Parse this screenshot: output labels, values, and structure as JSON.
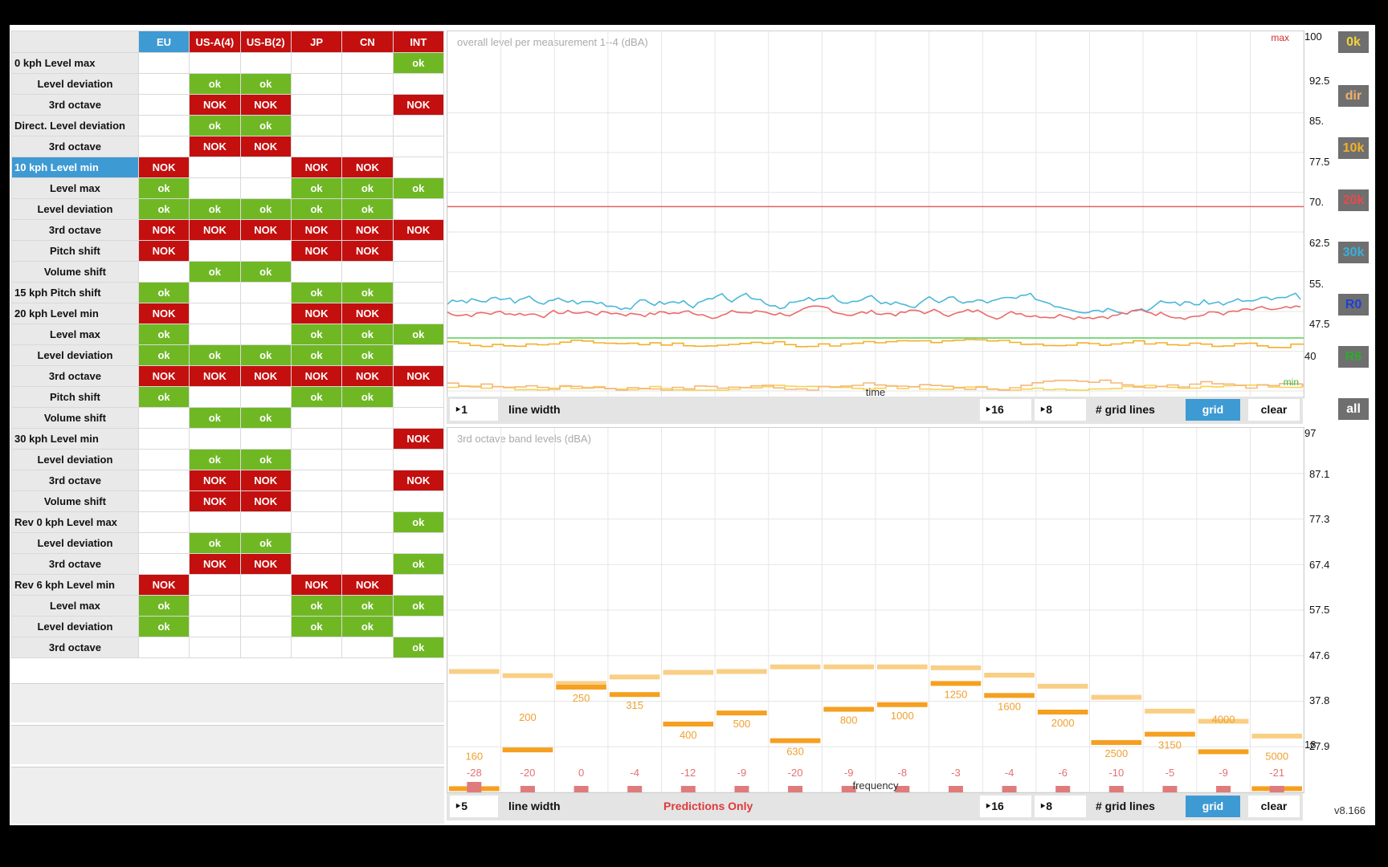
{
  "table": {
    "columns": [
      {
        "label": "EU",
        "style": "hdr"
      },
      {
        "label": "US-A(4)",
        "style": "hdrr"
      },
      {
        "label": "US-B(2)",
        "style": "hdrr"
      },
      {
        "label": "JP",
        "style": "hdrr"
      },
      {
        "label": "CN",
        "style": "hdrr"
      },
      {
        "label": "INT",
        "style": "hdrr"
      }
    ],
    "rows": [
      {
        "label": "0 kph   Level max",
        "indent": false,
        "cells": [
          "",
          "",
          "",
          "",
          "",
          "ok"
        ]
      },
      {
        "label": "Level deviation",
        "indent": true,
        "cells": [
          "",
          "ok",
          "ok",
          "",
          "",
          ""
        ]
      },
      {
        "label": "3rd octave",
        "indent": true,
        "cells": [
          "",
          "NOK",
          "NOK",
          "",
          "",
          "NOK"
        ]
      },
      {
        "label": "Direct. Level deviation",
        "indent": false,
        "cells": [
          "",
          "ok",
          "ok",
          "",
          "",
          ""
        ]
      },
      {
        "label": "3rd octave",
        "indent": true,
        "cells": [
          "",
          "NOK",
          "NOK",
          "",
          "",
          ""
        ]
      },
      {
        "label": "10 kph Level min",
        "indent": false,
        "selected": true,
        "cells": [
          "NOK",
          "",
          "",
          "NOK",
          "NOK",
          ""
        ]
      },
      {
        "label": "Level max",
        "indent": true,
        "cells": [
          "ok",
          "",
          "",
          "ok",
          "ok",
          "ok"
        ]
      },
      {
        "label": "Level deviation",
        "indent": true,
        "cells": [
          "ok",
          "ok",
          "ok",
          "ok",
          "ok",
          ""
        ]
      },
      {
        "label": "3rd octave",
        "indent": true,
        "cells": [
          "NOK",
          "NOK",
          "NOK",
          "NOK",
          "NOK",
          "NOK"
        ]
      },
      {
        "label": "Pitch shift",
        "indent": true,
        "cells": [
          "NOK",
          "",
          "",
          "NOK",
          "NOK",
          ""
        ]
      },
      {
        "label": "Volume shift",
        "indent": true,
        "cells": [
          "",
          "ok",
          "ok",
          "",
          "",
          ""
        ]
      },
      {
        "label": "15 kph Pitch shift",
        "indent": false,
        "cells": [
          "ok",
          "",
          "",
          "ok",
          "ok",
          ""
        ]
      },
      {
        "label": "20 kph Level min",
        "indent": false,
        "cells": [
          "NOK",
          "",
          "",
          "NOK",
          "NOK",
          ""
        ]
      },
      {
        "label": "Level max",
        "indent": true,
        "cells": [
          "ok",
          "",
          "",
          "ok",
          "ok",
          "ok"
        ]
      },
      {
        "label": "Level deviation",
        "indent": true,
        "cells": [
          "ok",
          "ok",
          "ok",
          "ok",
          "ok",
          ""
        ]
      },
      {
        "label": "3rd octave",
        "indent": true,
        "cells": [
          "NOK",
          "NOK",
          "NOK",
          "NOK",
          "NOK",
          "NOK"
        ]
      },
      {
        "label": "Pitch shift",
        "indent": true,
        "cells": [
          "ok",
          "",
          "",
          "ok",
          "ok",
          ""
        ]
      },
      {
        "label": "Volume shift",
        "indent": true,
        "cells": [
          "",
          "ok",
          "ok",
          "",
          "",
          ""
        ]
      },
      {
        "label": "30 kph Level min",
        "indent": false,
        "cells": [
          "",
          "",
          "",
          "",
          "",
          "NOK"
        ]
      },
      {
        "label": "Level deviation",
        "indent": true,
        "cells": [
          "",
          "ok",
          "ok",
          "",
          "",
          ""
        ]
      },
      {
        "label": "3rd octave",
        "indent": true,
        "cells": [
          "",
          "NOK",
          "NOK",
          "",
          "",
          "NOK"
        ]
      },
      {
        "label": "Volume shift",
        "indent": true,
        "cells": [
          "",
          "NOK",
          "NOK",
          "",
          "",
          ""
        ]
      },
      {
        "label": "Rev 0 kph Level max",
        "indent": false,
        "cells": [
          "",
          "",
          "",
          "",
          "",
          "ok"
        ]
      },
      {
        "label": "Level deviation",
        "indent": true,
        "cells": [
          "",
          "ok",
          "ok",
          "",
          "",
          ""
        ]
      },
      {
        "label": "3rd octave",
        "indent": true,
        "cells": [
          "",
          "NOK",
          "NOK",
          "",
          "",
          "ok"
        ]
      },
      {
        "label": "Rev 6 kph Level min",
        "indent": false,
        "cells": [
          "NOK",
          "",
          "",
          "NOK",
          "NOK",
          ""
        ]
      },
      {
        "label": "Level max",
        "indent": true,
        "cells": [
          "ok",
          "",
          "",
          "ok",
          "ok",
          "ok"
        ]
      },
      {
        "label": "Level deviation",
        "indent": true,
        "cells": [
          "ok",
          "",
          "",
          "ok",
          "ok",
          ""
        ]
      },
      {
        "label": "3rd octave",
        "indent": true,
        "cells": [
          "",
          "",
          "",
          "",
          "",
          "ok"
        ]
      }
    ]
  },
  "chart_data": [
    {
      "type": "line",
      "title": "overall level per measurement 1--4 (dBA)",
      "xlabel": "time",
      "ylim": [
        40,
        100
      ],
      "ticks": [
        "100",
        "92.5",
        "85.",
        "77.5",
        "70.",
        "62.5",
        "55.",
        "47.5",
        "40"
      ],
      "max_label": "max",
      "min_label": "min",
      "max_line": 74.8,
      "min_line": 50.0,
      "series": [
        {
          "color": "#4ab8d8",
          "base": 56.8,
          "amp": 1.6,
          "seed": 3
        },
        {
          "color": "#ec6a6a",
          "base": 54.8,
          "amp": 1.2,
          "seed": 7
        },
        {
          "color": "#f2b02a",
          "base": 48.9,
          "amp": 1.0,
          "seed": 11
        },
        {
          "color": "#f7d255",
          "base": 40.6,
          "amp": 0.8,
          "seed": 13
        },
        {
          "color": "#f5b878",
          "base": 41.0,
          "amp": 1.2,
          "seed": 17
        }
      ]
    },
    {
      "type": "bar",
      "title": "3rd octave band levels (dBA)",
      "xlabel": "frequency",
      "ylim": [
        18,
        97
      ],
      "ticks": [
        "97",
        "87.1",
        "77.3",
        "67.4",
        "57.5",
        "47.6",
        "37.8",
        "27.9",
        "18"
      ],
      "categories": [
        "160",
        "200",
        "250",
        "315",
        "400",
        "500",
        "630",
        "800",
        "1000",
        "1250",
        "1600",
        "2000",
        "2500",
        "3150",
        "4000",
        "5000"
      ],
      "values": [
        18.8,
        27.2,
        40.8,
        39.2,
        32.8,
        35.2,
        29.2,
        36.0,
        37.0,
        41.6,
        39.0,
        35.4,
        28.8,
        30.6,
        26.8,
        18.8
      ],
      "limit_values": [
        44.2,
        43.3,
        41.6,
        43.0,
        44.0,
        44.2,
        45.2,
        45.2,
        45.2,
        45.0,
        43.4,
        41.0,
        38.6,
        35.6,
        33.4,
        30.2
      ],
      "deviation_labels": [
        "-28",
        "-20",
        "0",
        "-4",
        "-12",
        "-9",
        "-20",
        "-9",
        "-8",
        "-3",
        "-4",
        "-6",
        "-10",
        "-5",
        "-9",
        "-21"
      ]
    }
  ],
  "toolbar_top": {
    "width_value": "1",
    "width_label": "line width",
    "grid_a": "16",
    "grid_b": "8",
    "grid_label": "# grid lines",
    "grid_button": "grid",
    "clear_button": "clear"
  },
  "toolbar_bottom": {
    "width_value": "5",
    "width_label": "line width",
    "status": "Predictions Only",
    "grid_a": "16",
    "grid_b": "8",
    "grid_label": "# grid lines",
    "grid_button": "grid",
    "clear_button": "clear"
  },
  "side_buttons": [
    {
      "label": "0k",
      "color": "#f2d43a"
    },
    {
      "label": "dir",
      "color": "#f0b070"
    },
    {
      "label": "10k",
      "color": "#f2b02a"
    },
    {
      "label": "20k",
      "color": "#e84a4a"
    },
    {
      "label": "30k",
      "color": "#3ab0d8"
    },
    {
      "label": "R0",
      "color": "#1f3fd8"
    },
    {
      "label": "R6",
      "color": "#2faa2f"
    },
    {
      "label": "all",
      "color": "#ffffff"
    }
  ],
  "version": "v8.166"
}
